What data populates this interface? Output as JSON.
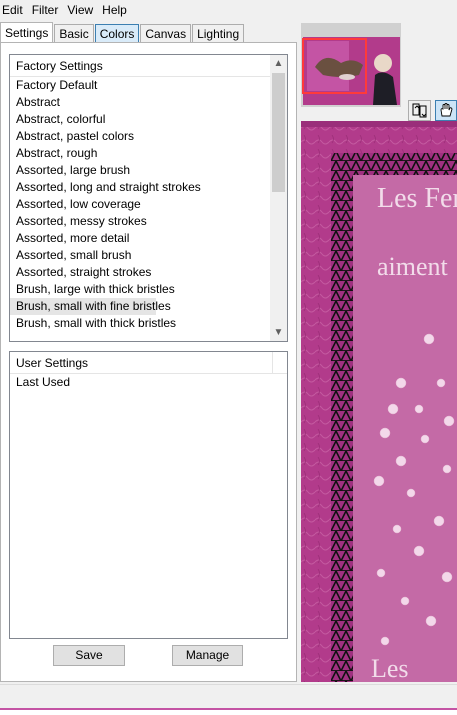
{
  "menu": [
    "Edit",
    "Filter",
    "View",
    "Help"
  ],
  "tabs": [
    {
      "label": "Settings",
      "active": true
    },
    {
      "label": "Basic"
    },
    {
      "label": "Colors",
      "highlighted": true
    },
    {
      "label": "Canvas"
    },
    {
      "label": "Lighting"
    }
  ],
  "factory": {
    "header": "Factory Settings",
    "items": [
      "Factory Default",
      "Abstract",
      "Abstract, colorful",
      "Abstract, pastel colors",
      "Abstract, rough",
      "Assorted, large brush",
      "Assorted, long and straight strokes",
      "Assorted, low coverage",
      "Assorted, messy strokes",
      "Assorted, more detail",
      "Assorted, small brush",
      "Assorted, straight strokes",
      "Brush, large with thick bristles",
      "Brush, small with fine bristles",
      "Brush, small with thick bristles"
    ],
    "selected": "Brush, small with fine bristles"
  },
  "user": {
    "header": "User Settings",
    "items": [
      "Last Used"
    ]
  },
  "buttons": {
    "save": "Save",
    "manage": "Manage"
  },
  "preview": {
    "text_line1": "Les Fem",
    "text_line2": "aiment",
    "text_line3": "Les"
  },
  "colors": {
    "accent": "#b23b8b",
    "frame_pink": "#c454a4"
  }
}
